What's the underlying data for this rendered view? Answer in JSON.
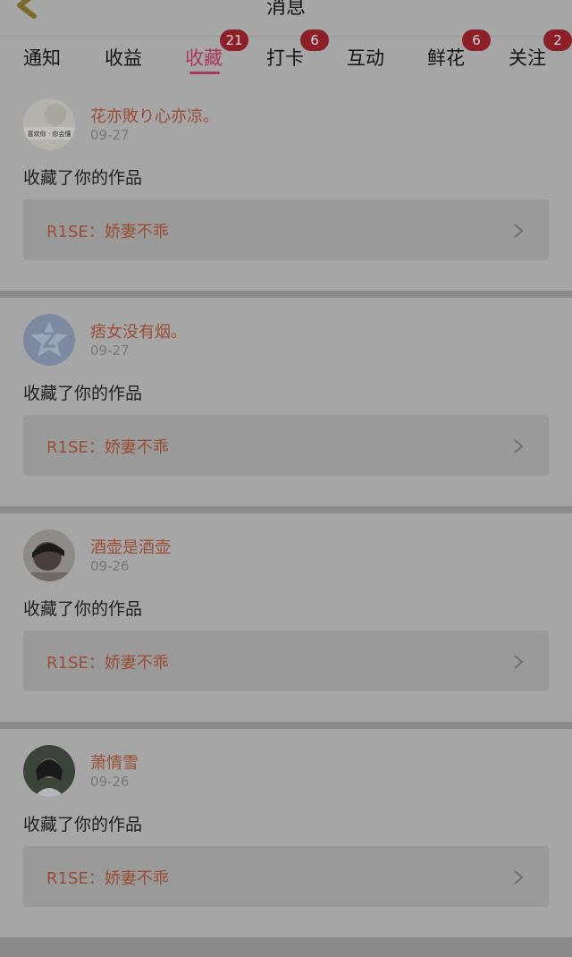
{
  "header": {
    "title": "消息"
  },
  "tabs": [
    {
      "label": "通知",
      "badge": ""
    },
    {
      "label": "收益",
      "badge": ""
    },
    {
      "label": "收藏",
      "badge": "21",
      "active": true
    },
    {
      "label": "打卡",
      "badge": "6"
    },
    {
      "label": "互动",
      "badge": ""
    },
    {
      "label": "鲜花",
      "badge": "6"
    },
    {
      "label": "关注",
      "badge": "2"
    }
  ],
  "items": [
    {
      "name": "花亦敗り心亦凉。",
      "date": "09-27",
      "action": "收藏了你的作品",
      "work": "R1SE：娇妻不乖",
      "avatar_text": "喜欢你 · 你会懂"
    },
    {
      "name": "痞女没有烟。",
      "date": "09-27",
      "action": "收藏了你的作品",
      "work": "R1SE：娇妻不乖"
    },
    {
      "name": "酒壶是酒壶",
      "date": "09-26",
      "action": "收藏了你的作品",
      "work": "R1SE：娇妻不乖"
    },
    {
      "name": "萧情雪",
      "date": "09-26",
      "action": "收藏了你的作品",
      "work": "R1SE：娇妻不乖"
    }
  ],
  "colors": {
    "accent": "#a6395c",
    "badge": "#8c1f27",
    "username": "#9a4d35"
  }
}
